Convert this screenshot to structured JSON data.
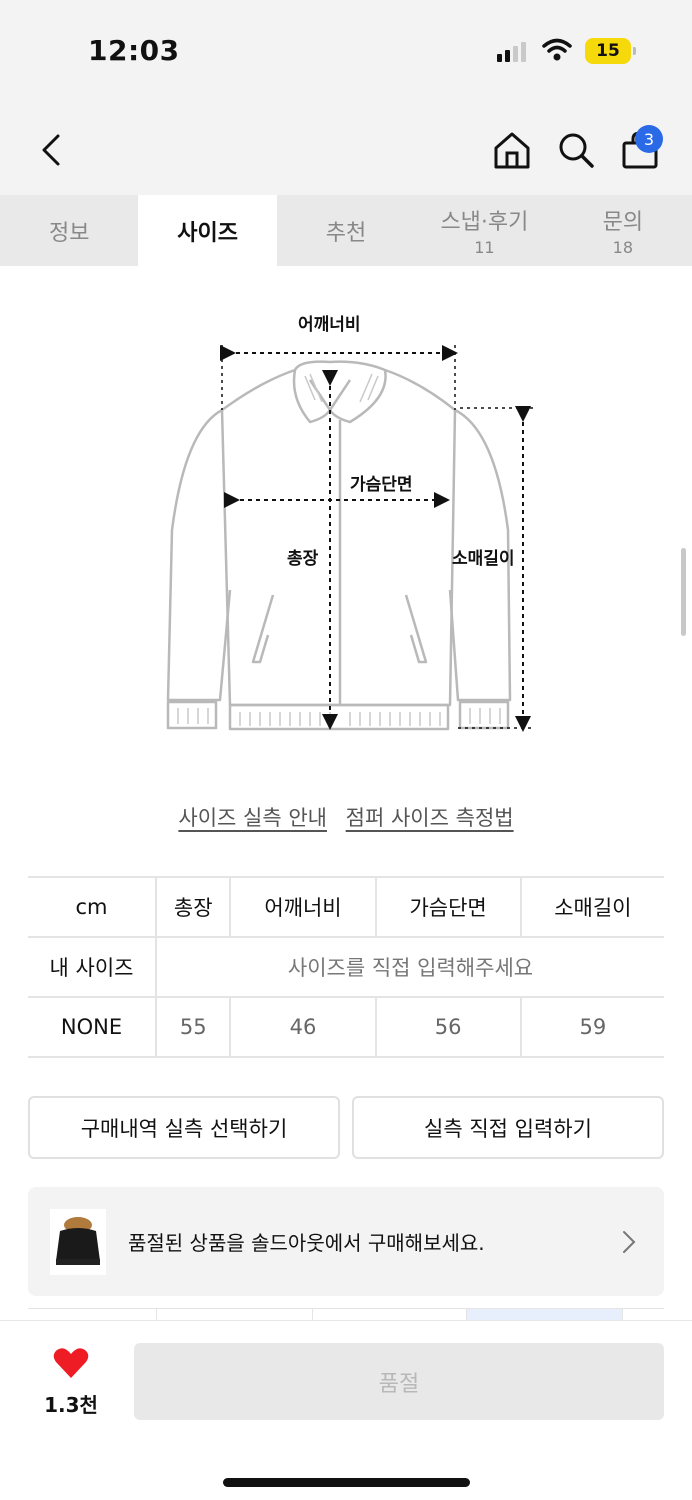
{
  "status_bar": {
    "time": "12:03",
    "battery": "15"
  },
  "nav": {
    "cart_count": "3"
  },
  "tabs": [
    {
      "label": "정보",
      "count": ""
    },
    {
      "label": "사이즈",
      "count": ""
    },
    {
      "label": "추천",
      "count": ""
    },
    {
      "label": "스냅·후기",
      "count": "11"
    },
    {
      "label": "문의",
      "count": "18"
    }
  ],
  "diagram": {
    "shoulder_label": "어깨너비",
    "chest_label": "가슴단면",
    "length_label": "총장",
    "sleeve_label": "소매길이"
  },
  "guide_links": {
    "measure_guide": "사이즈 실측 안내",
    "jumper_method": "점퍼 사이즈 측정법"
  },
  "size_table": {
    "unit": "cm",
    "headers": [
      "총장",
      "어깨너비",
      "가슴단면",
      "소매길이"
    ],
    "my_size_label": "내 사이즈",
    "my_size_hint": "사이즈를 직접 입력해주세요",
    "rows": [
      {
        "size": "NONE",
        "values": [
          "55",
          "46",
          "56",
          "59"
        ]
      }
    ]
  },
  "actions": {
    "select_purchase": "구매내역 실측 선택하기",
    "manual_input": "실측 직접 입력하기"
  },
  "soldout_banner": {
    "text": "품절된 상품을 솔드아웃에서 구매해보세요."
  },
  "bottom": {
    "like_count": "1.3천",
    "cta_label": "품절"
  },
  "colors": {
    "accent_blue": "#2a6ae6",
    "heart_red": "#ee1c25",
    "battery_yellow": "#f5d90a"
  }
}
